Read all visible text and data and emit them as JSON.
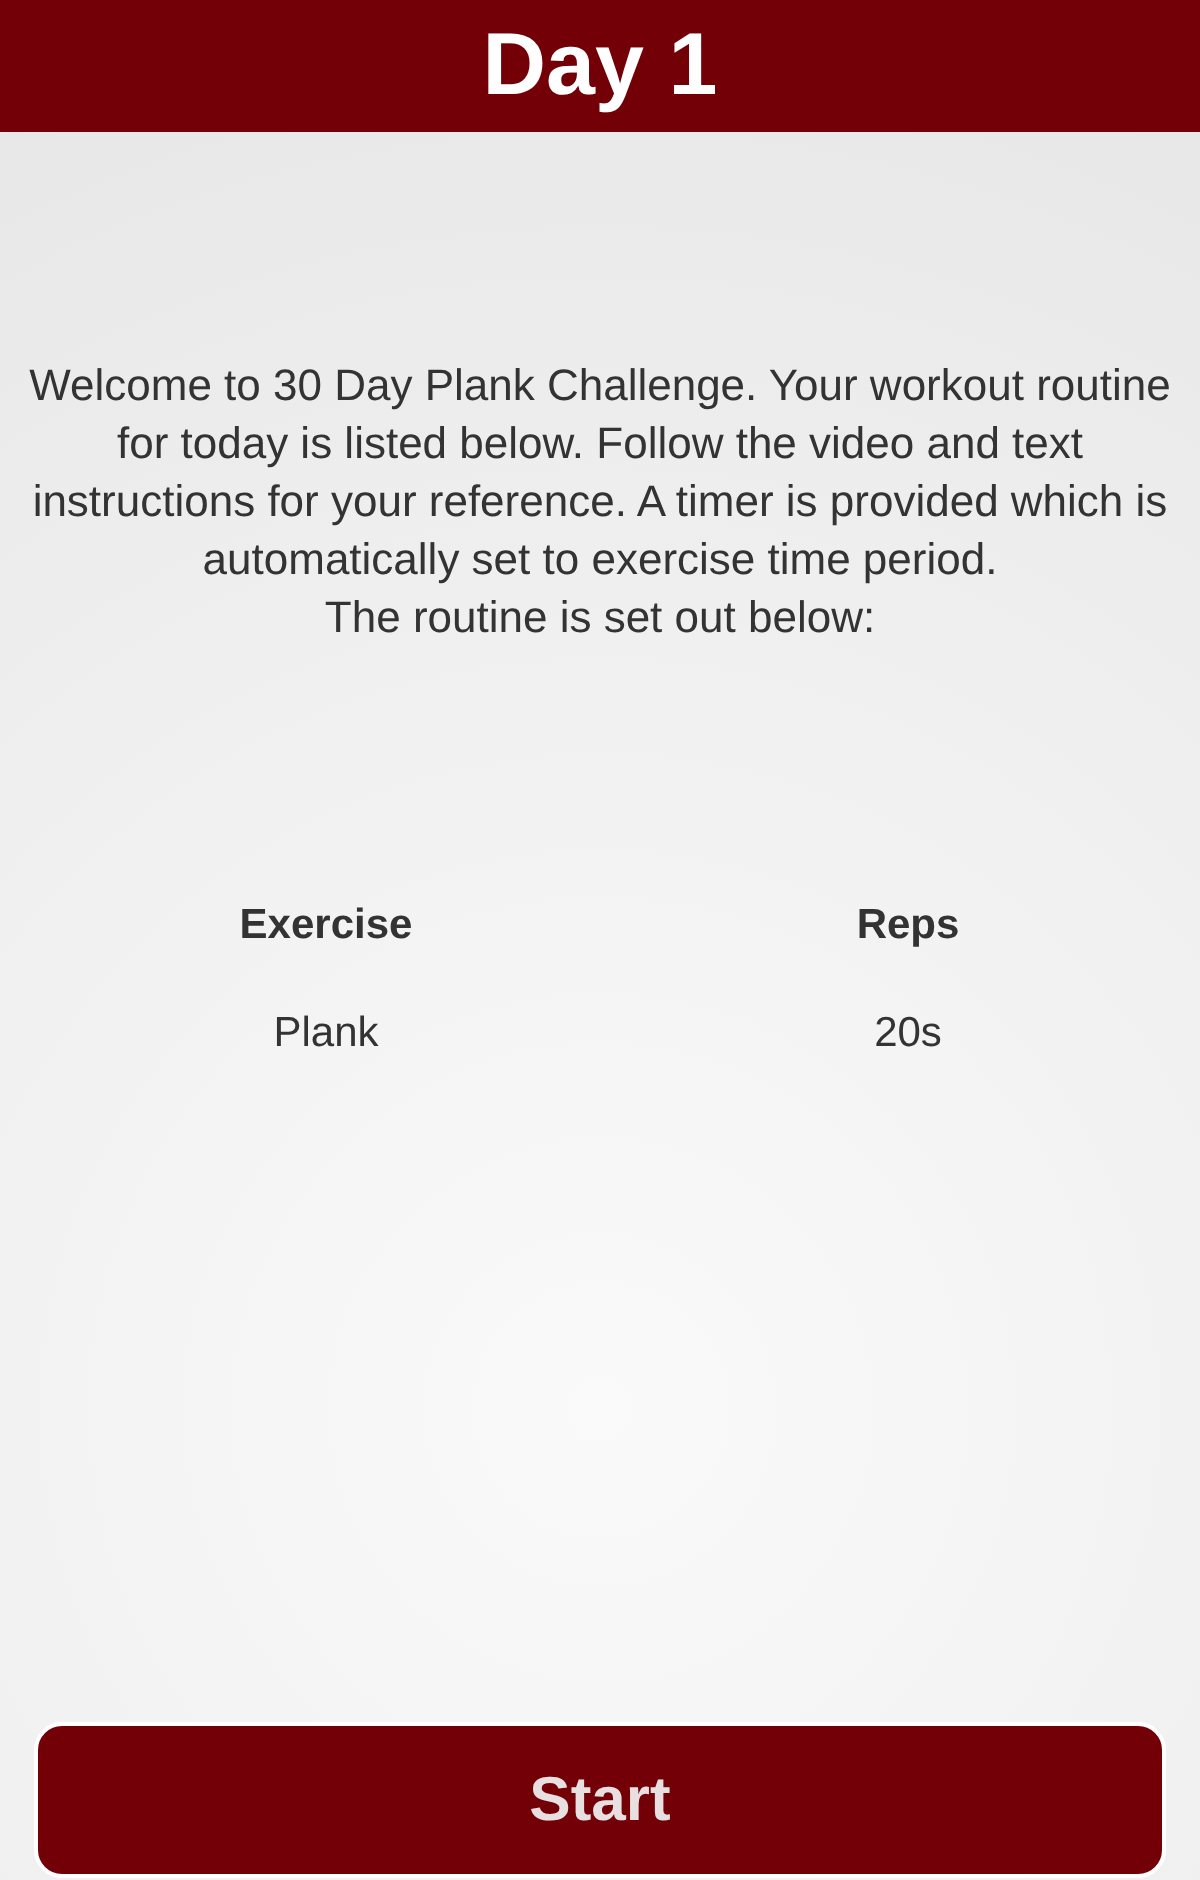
{
  "header": {
    "title": "Day 1"
  },
  "intro": [
    "Welcome to 30 Day Plank Challenge. Your workout routine for today is listed below. Follow the video and text instructions for your reference. A timer is provided which is automatically set to exercise time period.",
    "The routine is set out below:"
  ],
  "table": {
    "columns": [
      "Exercise",
      "Reps"
    ],
    "rows": [
      [
        "Plank",
        "20s"
      ]
    ]
  },
  "button": {
    "label": "Start"
  }
}
